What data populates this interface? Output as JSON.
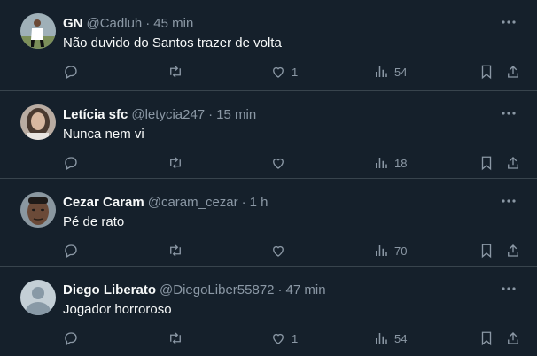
{
  "tweets": [
    {
      "name": "GN",
      "handle": "@Cadluh",
      "time": "45 min",
      "text": "Não duvido do Santos trazer de volta",
      "replies": "",
      "retweets": "",
      "likes": "1",
      "views": "54",
      "avatar_icon": "soccer-player-photo",
      "avatar_color": "#6e8a96"
    },
    {
      "name": "Letícia sfc",
      "handle": "@letycia247",
      "time": "15 min",
      "text": "Nunca nem vi",
      "replies": "",
      "retweets": "",
      "likes": "",
      "views": "18",
      "avatar_icon": "woman-photo",
      "avatar_color": "#a8978a"
    },
    {
      "name": "Cezar Caram",
      "handle": "@caram_cezar",
      "time": "1 h",
      "text": "Pé de rato",
      "replies": "",
      "retweets": "",
      "likes": "",
      "views": "70",
      "avatar_icon": "man-face-photo",
      "avatar_color": "#5b4a3f"
    },
    {
      "name": "Diego Liberato",
      "handle": "@DiegoLiber55872",
      "time": "47 min",
      "text": "Jogador horroroso",
      "replies": "",
      "retweets": "",
      "likes": "1",
      "views": "54",
      "avatar_icon": "default-user-icon",
      "avatar_color": "#c4cfd6"
    }
  ],
  "colors": {
    "background": "#15202b",
    "text_primary": "#f7f9f9",
    "text_secondary": "#8b98a5",
    "divider": "#38444d"
  }
}
